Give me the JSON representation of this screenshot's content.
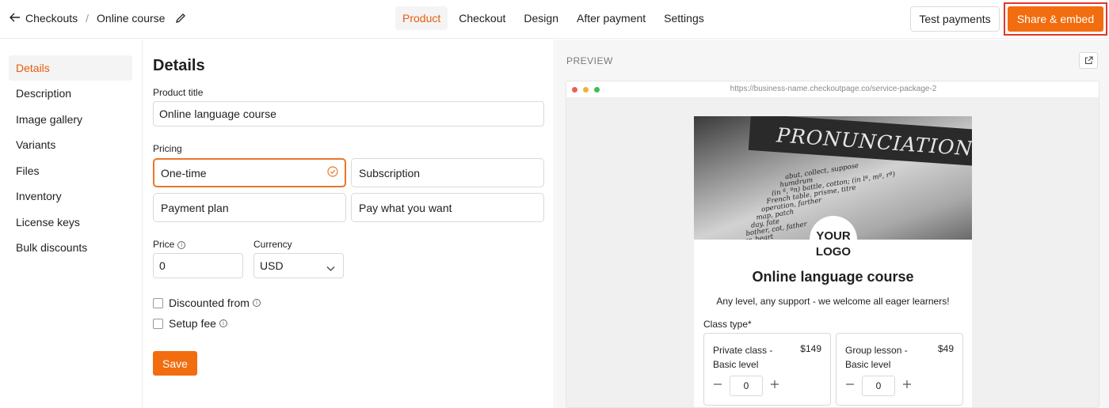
{
  "header": {
    "back_label": "Checkouts",
    "crumb_current": "Online course",
    "tabs": [
      {
        "label": "Product"
      },
      {
        "label": "Checkout"
      },
      {
        "label": "Design"
      },
      {
        "label": "After payment"
      },
      {
        "label": "Settings"
      }
    ],
    "active_tab": "Product",
    "test_payments_label": "Test payments",
    "share_label": "Share & embed",
    "accent_color": "#f26d0f",
    "highlight_color": "#e5352a"
  },
  "sidebar": {
    "items": [
      {
        "label": "Details"
      },
      {
        "label": "Description"
      },
      {
        "label": "Image gallery"
      },
      {
        "label": "Variants"
      },
      {
        "label": "Files"
      },
      {
        "label": "Inventory"
      },
      {
        "label": "License keys"
      },
      {
        "label": "Bulk discounts"
      }
    ],
    "active": "Details"
  },
  "form": {
    "heading": "Details",
    "product_title_label": "Product title",
    "product_title_value": "Online language course",
    "pricing_label": "Pricing",
    "pricing_options": [
      {
        "label": "One-time"
      },
      {
        "label": "Subscription"
      },
      {
        "label": "Payment plan"
      },
      {
        "label": "Pay what you want"
      }
    ],
    "pricing_selected": "One-time",
    "price_label": "Price",
    "price_value": "0",
    "currency_label": "Currency",
    "currency_value": "USD",
    "discounted_label": "Discounted from",
    "setup_fee_label": "Setup fee",
    "save_label": "Save"
  },
  "preview": {
    "label": "PREVIEW",
    "url": "https://business-name.checkoutpage.co/service-package-2",
    "hero_word": "PRONUNCIATION",
    "hero_lines": [
      "abut, collect, suppose",
      "humdrum",
      "(in ª, ªn) battle, cotton; (in lª, mª, rª)",
      "French table, prisme, titre",
      "operation, farther",
      "map, patch",
      "day, fate",
      "bother, cot, father",
      "car, heart"
    ],
    "logo_line1": "YOUR",
    "logo_line2": "LOGO",
    "product_title": "Online language course",
    "subtitle": "Any level, any support - we welcome all eager learners!",
    "class_type_label": "Class type",
    "classes": [
      {
        "name": "Private class - Basic level",
        "price": "$149",
        "qty": "0"
      },
      {
        "name": "Group lesson - Basic level",
        "price": "$49",
        "qty": "0"
      }
    ]
  }
}
